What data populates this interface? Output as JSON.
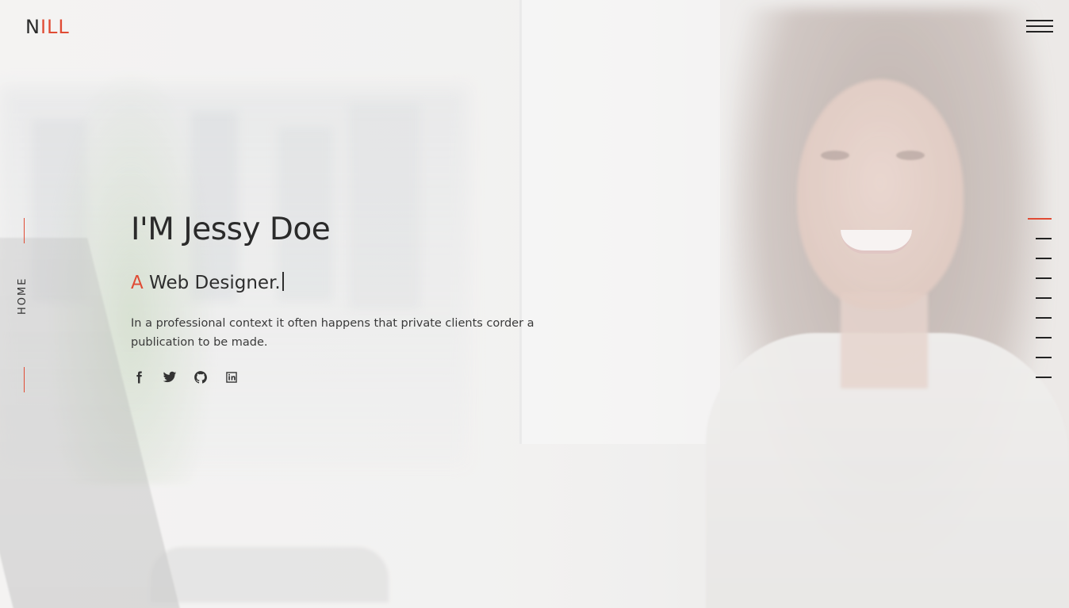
{
  "header": {
    "logo_prefix": "N",
    "logo_accent": "ILL"
  },
  "side_label": "HOME",
  "hero": {
    "title": "I'M Jessy Doe",
    "subtitle_accent": "A",
    "subtitle_text": "Web Designer.",
    "description": "In a professional context it often happens that private clients corder a publication to be made."
  },
  "social": [
    {
      "icon": "facebook-icon"
    },
    {
      "icon": "twitter-icon"
    },
    {
      "icon": "github-icon"
    },
    {
      "icon": "linkedin-icon"
    }
  ],
  "page_nav": {
    "count": 9,
    "active_index": 0
  },
  "colors": {
    "accent": "#e04b34",
    "text": "#2a2a2a",
    "background": "#f3f2f1"
  }
}
